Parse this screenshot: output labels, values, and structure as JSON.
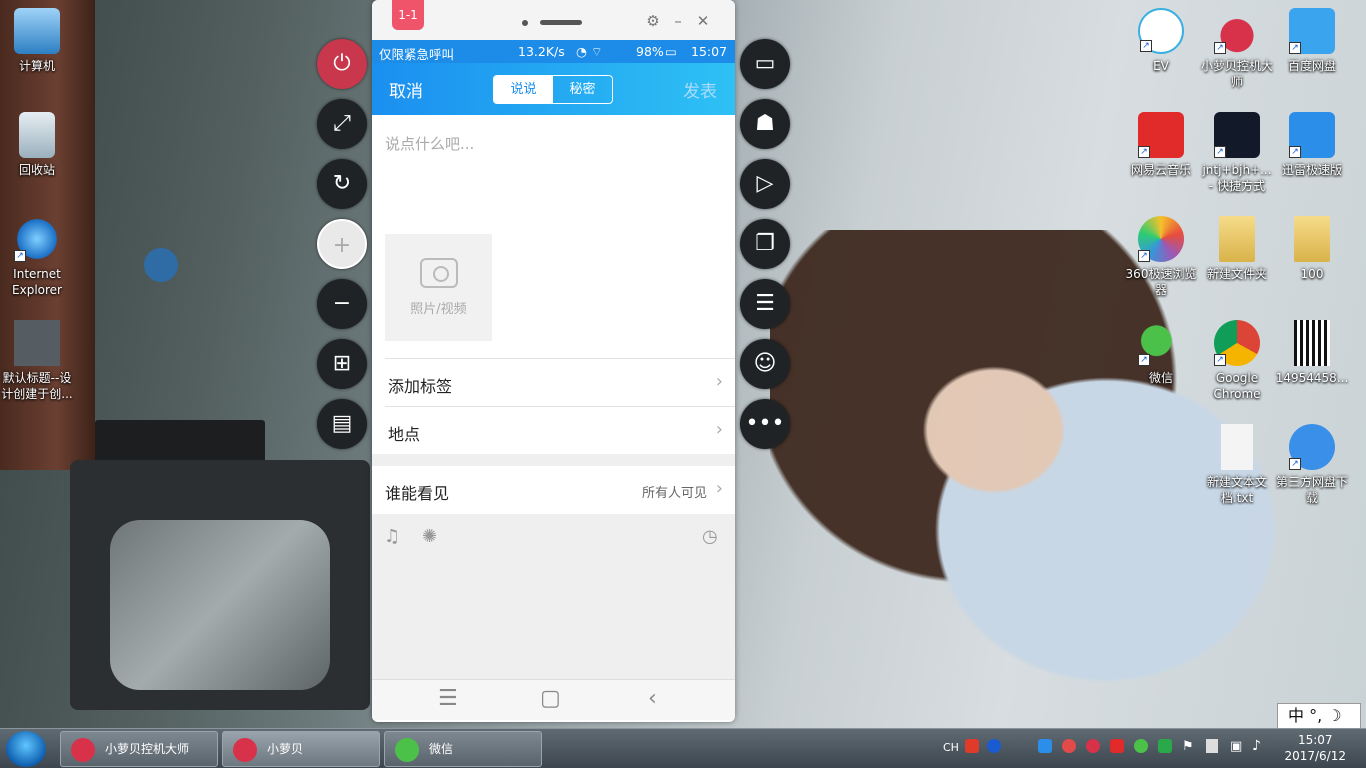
{
  "desktop": {
    "left_icons": [
      {
        "label": "计算机",
        "icon": "computer-icon"
      },
      {
        "label": "回收站",
        "icon": "recycle-bin-icon"
      },
      {
        "label": "Internet Explorer",
        "icon": "ie-icon"
      },
      {
        "label": "默认标题--设计创建于创...",
        "icon": "image-file-icon"
      }
    ],
    "right_icons": [
      {
        "label": "EV",
        "icon": "ev-icon"
      },
      {
        "label": "小萝贝控机大师",
        "icon": "radish-icon"
      },
      {
        "label": "百度网盘",
        "icon": "baidu-cloud-icon"
      },
      {
        "label": "网易云音乐",
        "icon": "netease-music-icon"
      },
      {
        "label": "jntj+bjh+... - 快捷方式",
        "icon": "shortcut-icon"
      },
      {
        "label": "迅雷极速版",
        "icon": "thunder-icon"
      },
      {
        "label": "360极速浏览器",
        "icon": "360-browser-icon"
      },
      {
        "label": "新建文件夹",
        "icon": "folder-icon"
      },
      {
        "label": "100",
        "icon": "folder-icon"
      },
      {
        "label": "微信",
        "icon": "wechat-icon"
      },
      {
        "label": "Google Chrome",
        "icon": "chrome-icon"
      },
      {
        "label": "14954458...",
        "icon": "qr-image-icon"
      },
      {
        "label": "新建文本文档.txt",
        "icon": "text-file-icon"
      },
      {
        "label": "第三方网盘下载",
        "icon": "download-icon"
      }
    ]
  },
  "phone": {
    "tag": "1-1",
    "status": {
      "carrier": "仅限紧急呼叫",
      "speed": "13.2K/s",
      "battery": "98%",
      "time": "15:07"
    },
    "appbar": {
      "cancel": "取消",
      "seg_left": "说说",
      "seg_right": "秘密",
      "publish": "发表"
    },
    "compose": {
      "placeholder": "说点什么吧...",
      "media_label": "照片/视频"
    },
    "rows": {
      "tag": "添加标签",
      "location": "地点",
      "visibility": "谁能看见",
      "visibility_value": "所有人可见"
    }
  },
  "taskbar": {
    "items": [
      {
        "label": "小萝贝控机大师"
      },
      {
        "label": "小萝贝"
      },
      {
        "label": "微信"
      }
    ],
    "lang": "CH",
    "clock_time": "15:07",
    "clock_date": "2017/6/12",
    "ime": "中 °, ☽"
  }
}
